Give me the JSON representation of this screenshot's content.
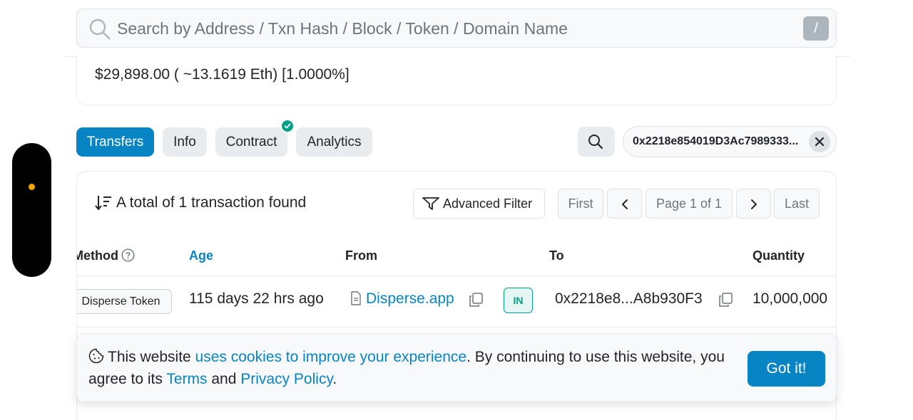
{
  "search": {
    "placeholder": "Search by Address / Txn Hash / Block / Token / Domain Name",
    "shortcut": "/"
  },
  "value_summary": "$29,898.00 ( ~13.1619 Eth) [1.0000%]",
  "tabs": [
    {
      "label": "Transfers",
      "active": true
    },
    {
      "label": "Info",
      "active": false
    },
    {
      "label": "Contract",
      "active": false,
      "verified": true
    },
    {
      "label": "Analytics",
      "active": false
    }
  ],
  "address_filter": "0x2218e854019D3Ac7989333...",
  "toolbar": {
    "total_text": "A total of 1 transaction found",
    "advanced_filter": "Advanced Filter",
    "first": "First",
    "page": "Page 1 of 1",
    "last": "Last"
  },
  "table": {
    "columns": [
      "Method",
      "Age",
      "From",
      "To",
      "Quantity"
    ],
    "rows": [
      {
        "method": "Disperse Token",
        "age": "115 days 22 hrs ago",
        "from": "Disperse.app",
        "direction": "IN",
        "to": "0x2218e8...A8b930F3",
        "quantity": "10,000,000"
      }
    ]
  },
  "cookie": {
    "text_1": "This website ",
    "link_1": "uses cookies to improve your experience",
    "text_2": ". By continuing to use this website, you agree to its ",
    "link_2": "Terms",
    "text_3": " and ",
    "link_3": "Privacy Policy",
    "text_4": ".",
    "button": "Got it!"
  },
  "colors": {
    "primary": "#0784c3",
    "success": "#00a186",
    "handle_dot": "#f7a600"
  }
}
